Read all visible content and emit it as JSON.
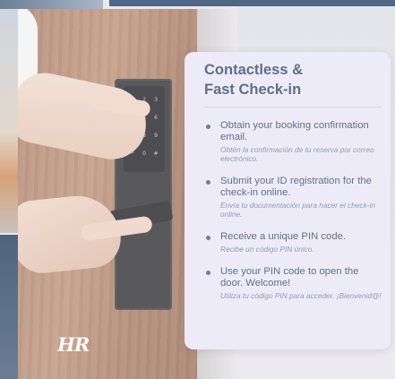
{
  "brand": {
    "logo_text": "HR"
  },
  "lock": {
    "keys": [
      "1",
      "2",
      "3",
      "4",
      "5",
      "6",
      "7",
      "8",
      "9",
      "*",
      "0",
      "#"
    ]
  },
  "card": {
    "title_line1": "Contactless &",
    "title_line2": "Fast Check-in",
    "steps": [
      {
        "text": "Obtain your booking confirmation email.",
        "subtext": "Obtén la confirmación de tu reserva por correo electrónico."
      },
      {
        "text": "Submit your ID registration for the check-in online.",
        "subtext": "Envía tu documentación para hacer el check-in online."
      },
      {
        "text": "Receive a unique PIN code.",
        "subtext": "Recibe un código PIN único."
      },
      {
        "text": "Use your PIN code to open the door. Welcome!",
        "subtext": "Utiliza tu código PIN para acceder. ¡Bienvenid@!"
      }
    ]
  },
  "colors": {
    "card_bg": "#eeebf8",
    "title": "#5d6f8a",
    "body_text": "#5f7089",
    "sub_text": "#8f9cb5",
    "top_strip": "#4f6684"
  }
}
